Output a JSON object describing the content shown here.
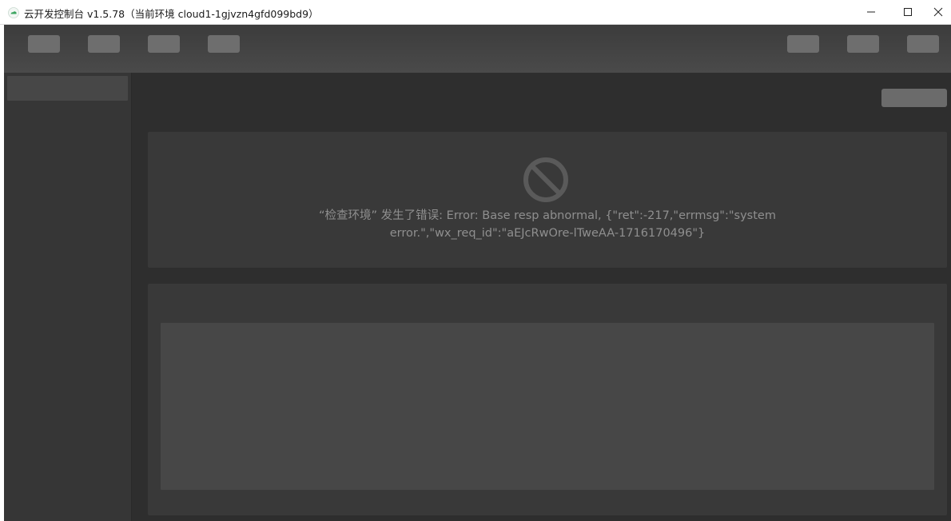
{
  "window": {
    "title": "云开发控制台 v1.5.78（当前环境 cloud1-1gjvzn4gfd099bd9）",
    "app_icon": "cloud-icon",
    "controls": [
      "minimize-icon",
      "maximize-icon",
      "close-icon"
    ]
  },
  "toolbar": {
    "left_buttons": 4,
    "right_buttons": 3
  },
  "error": {
    "icon": "no-entry-icon",
    "message": "“检查环境” 发生了错误: Error: Base resp abnormal, {\"ret\":-217,\"errmsg\":\"system error.\",\"wx_req_id\":\"aEJcRwOre-lTweAA-1716170496\"}"
  },
  "colors": {
    "background": "#2d2d2d",
    "panel": "#393939",
    "placeholder": "#6e6e6e",
    "error_text": "#8f8f8f"
  }
}
